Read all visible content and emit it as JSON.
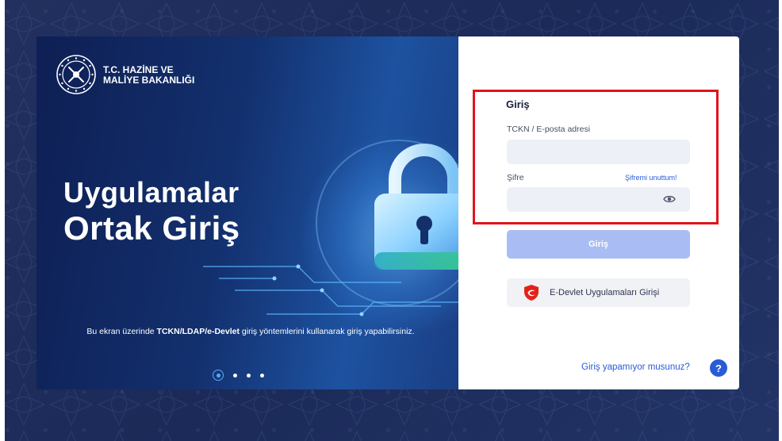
{
  "organization": {
    "line1": "T.C. HAZİNE VE",
    "line2": "MALİYE BAKANLIĞI",
    "logo_icon": "ministry-emblem-icon"
  },
  "hero": {
    "title_line1": "Uygulamalar",
    "title_line2": "Ortak Giriş",
    "description_prefix": "Bu ekran üzerinde ",
    "description_bold": "TCKN/LDAP/e-Devlet",
    "description_suffix": " giriş yöntemlerini kullanarak giriş yapabilirsiniz.",
    "illustration_icon": "padlock-icon",
    "carousel": {
      "slide_count": 4,
      "active_index": 0
    }
  },
  "login": {
    "title": "Giriş",
    "username_label": "TCKN / E-posta adresi",
    "username_value": "",
    "password_label": "Şifre",
    "password_value": "",
    "forgot_link": "Şifremi unuttum!",
    "password_toggle_icon": "eye-icon",
    "submit_label": "Giriş",
    "edevlet_label": "E-Devlet Uygulamaları Girişi",
    "edevlet_icon": "e-devlet-shield-icon"
  },
  "help": {
    "text": "Giriş yapamıyor musunuz?",
    "icon_glyph": "?"
  },
  "colors": {
    "accent": "#2a5bd7",
    "submit_button": "#a9bcf3",
    "highlight": "#e0141c",
    "hero_dark": "#0e1f54",
    "input_bg": "#eef0f7"
  }
}
